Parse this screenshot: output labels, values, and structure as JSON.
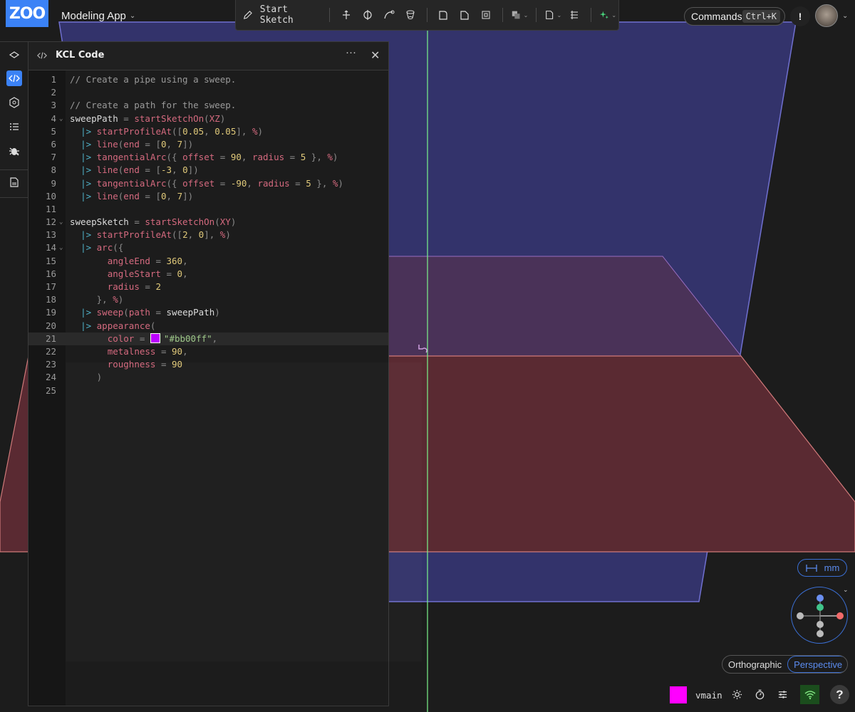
{
  "app": {
    "logo_text": "ZOO",
    "project_name": "Modeling App",
    "brand_color": "#3b82f6"
  },
  "toolbar": {
    "start_sketch_label": "Start Sketch",
    "tool_icons": [
      "extrude-icon",
      "revolve-icon",
      "sweep-icon",
      "loft-icon",
      "fillet-icon",
      "chamfer-icon",
      "shell-icon",
      "boolean-icon",
      "plane-icon",
      "helix-icon",
      "text-to-cad-icon"
    ]
  },
  "commands": {
    "label": "Commands",
    "shortcut": "Ctrl+K"
  },
  "alert_label": "!",
  "code_panel": {
    "title": "KCL Code",
    "more_label": "···",
    "close_label": "✕",
    "active_line": 21,
    "lines": [
      "// Create a pipe using a sweep.",
      "",
      "// Create a path for the sweep.",
      "sweepPath = startSketchOn(XZ)",
      "  |> startProfileAt([0.05, 0.05], %)",
      "  |> line(end = [0, 7])",
      "  |> tangentialArc({ offset = 90, radius = 5 }, %)",
      "  |> line(end = [-3, 0])",
      "  |> tangentialArc({ offset = -90, radius = 5 }, %)",
      "  |> line(end = [0, 7])",
      "",
      "sweepSketch = startSketchOn(XY)",
      "  |> startProfileAt([2, 0], %)",
      "  |> arc({",
      "       angleEnd = 360,",
      "       angleStart = 0,",
      "       radius = 2",
      "     }, %)",
      "  |> sweep(path = sweepPath)",
      "  |> appearance(",
      "       color = \"#bb00ff\",",
      "       metalness = 90,",
      "       roughness = 90",
      "     )",
      ""
    ],
    "color_swatch": "#bb00ff"
  },
  "units": {
    "label": "mm"
  },
  "projection": {
    "options": [
      "Orthographic",
      "Perspective"
    ],
    "selected": "Perspective"
  },
  "status": {
    "swatch_color": "#ff00ff",
    "branch": "vmain",
    "help_label": "?"
  },
  "scene": {
    "xz_plane_color": "#3a3a78",
    "xy_plane_color": "#5a2a32",
    "yz_plane_color": "#4a3060",
    "axis_color": "#7cf58a"
  }
}
